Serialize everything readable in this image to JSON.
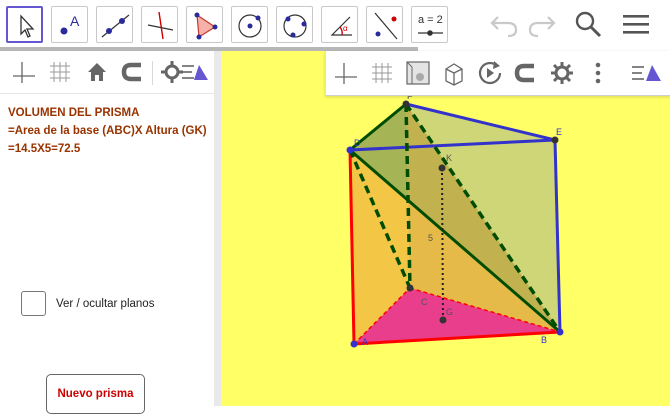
{
  "toolbar": {
    "tools": [
      {
        "name": "move-tool",
        "selected": true
      },
      {
        "name": "point-tool"
      },
      {
        "name": "line-tool"
      },
      {
        "name": "perpendicular-line-tool"
      },
      {
        "name": "polygon-tool"
      },
      {
        "name": "circle-center-point-tool"
      },
      {
        "name": "circle-through-points-tool"
      },
      {
        "name": "angle-tool"
      },
      {
        "name": "reflect-tool"
      },
      {
        "name": "slider-tool",
        "label": "a = 2"
      }
    ],
    "point_tool_letter": "A"
  },
  "algebra_view": {
    "title": "VOLUMEN DEL PRISMA",
    "line1": "=Area de la base (ABC)X Altura (GK)",
    "line2": "=14.5X5=72.5",
    "checkbox_label": "Ver / ocultar planos",
    "button_label": "Nuevo prisma"
  },
  "graphics": {
    "background": "#ffff66",
    "points": {
      "A": "A",
      "B": "B",
      "C": "C",
      "D": "D",
      "E": "E",
      "F": "F",
      "G": "G",
      "K": "K"
    },
    "height_label": "5"
  },
  "colors": {
    "accent": "#6557d2",
    "text_brown": "#993300",
    "button_red": "#cc0000",
    "edge_blue": "#3333cc",
    "edge_red": "#ff0000",
    "edge_green": "#004d00",
    "base_pink": "#e83e8c"
  }
}
